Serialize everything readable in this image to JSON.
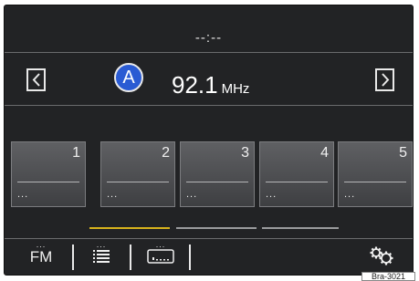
{
  "header": {
    "clock": "--:--"
  },
  "tuner": {
    "marker": "A",
    "frequency": "92.1",
    "unit": "MHz"
  },
  "presets": [
    {
      "number": "1",
      "name": "..."
    },
    {
      "number": "2",
      "name": "..."
    },
    {
      "number": "3",
      "name": "..."
    },
    {
      "number": "4",
      "name": "..."
    },
    {
      "number": "5",
      "name": "..."
    }
  ],
  "page_indicator": {
    "pages": 3,
    "active_page": 1,
    "active_color": "#d8b31c",
    "inactive_color": "#9a9b9d"
  },
  "bottom_bar": {
    "band": {
      "dots": "...",
      "label": "FM"
    },
    "list": {
      "dots": "..."
    },
    "media": {
      "dots": "..."
    }
  },
  "figure_tag": "Bra-3021",
  "icons": {
    "prev": "chevron-left-icon",
    "next": "chevron-right-icon",
    "list": "list-icon",
    "media": "media-icon",
    "settings": "settings-icon"
  },
  "colors": {
    "background": "#222325",
    "text": "#ffffff",
    "marker": "#2a5bd3"
  }
}
